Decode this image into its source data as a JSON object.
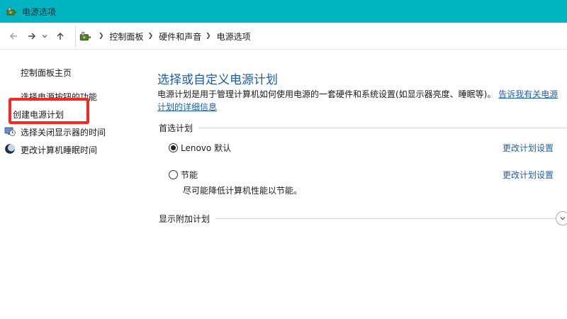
{
  "window": {
    "title": "电源选项"
  },
  "nav": {
    "breadcrumbs": [
      "控制面板",
      "硬件和声音",
      "电源选项"
    ]
  },
  "sidebar": {
    "items": [
      {
        "label": "控制面板主页"
      },
      {
        "label": "选择电源按钮的功能"
      },
      {
        "label": "创建电源计划"
      },
      {
        "label": "选择关闭显示器的时间"
      },
      {
        "label": "更改计算机睡眠时间"
      }
    ],
    "highlight_color": "#f22a22"
  },
  "main": {
    "heading": "选择或自定义电源计划",
    "description": "电源计划是用于管理计算机如何使用电源的一套硬件和系统设置(如显示器亮度、睡眠等)。",
    "description_link": "告诉我有关电源计划的详细信息",
    "preferred_label": "首选计划",
    "plans": [
      {
        "name": "Lenovo 默认",
        "selected": true,
        "change_link": "更改计划设置"
      },
      {
        "name": "节能",
        "selected": false,
        "description": "尽可能降低计算机性能以节能。",
        "change_link": "更改计划设置"
      }
    ],
    "additional_label": "显示附加计划"
  },
  "colors": {
    "titlebar": "#00b4c2",
    "link": "#1a5fb4",
    "heading": "#1f5ca3"
  },
  "icons": {
    "app": "power-options-icon",
    "back": "back-arrow-icon",
    "forward": "forward-arrow-icon",
    "recent": "chevron-down-icon",
    "up": "up-arrow-icon",
    "display": "monitor-clock-icon",
    "sleep": "moon-icon",
    "expand": "chevron-down-circle-icon"
  }
}
